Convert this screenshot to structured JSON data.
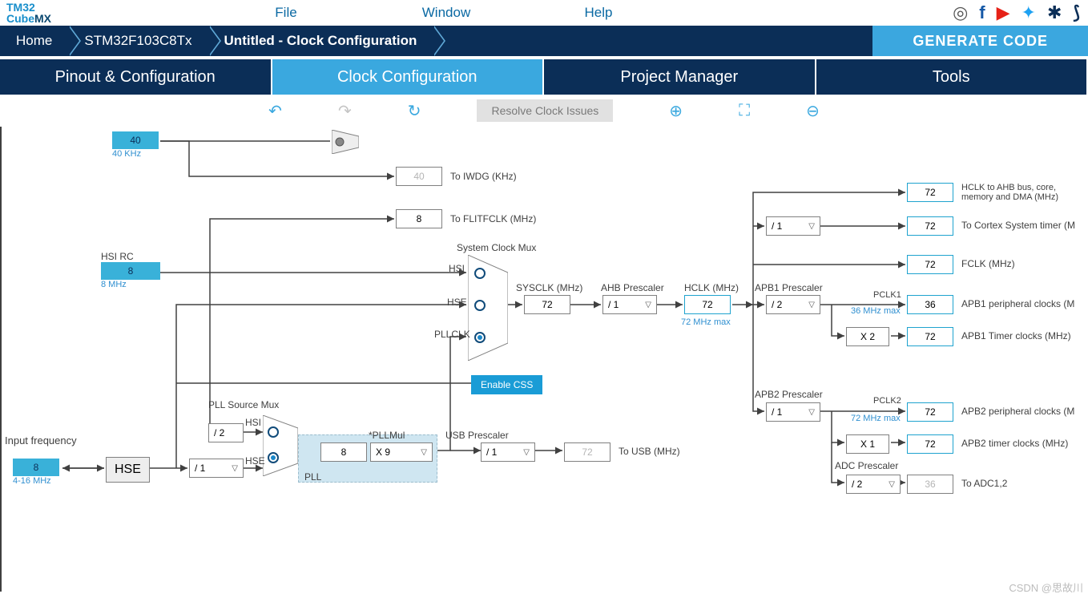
{
  "app_logo": {
    "l1": "TM32",
    "l2": "Cube",
    "l3": "MX"
  },
  "menu": {
    "file": "File",
    "window": "Window",
    "help": "Help"
  },
  "crumbs": {
    "home": "Home",
    "chip": "STM32F103C8Tx",
    "proj": "Untitled - Clock Configuration"
  },
  "generate": "GENERATE CODE",
  "tabs": {
    "pinout": "Pinout & Configuration",
    "clock": "Clock Configuration",
    "pm": "Project Manager",
    "tools": "Tools"
  },
  "toolbar": {
    "resolve": "Resolve Clock Issues"
  },
  "lsi": {
    "val": "40",
    "unit": "40 KHz"
  },
  "iwdg": {
    "val": "40",
    "label": "To IWDG (KHz)"
  },
  "flitf": {
    "val": "8",
    "label": "To FLITFCLK (MHz)"
  },
  "hsi": {
    "title": "HSI RC",
    "val": "8",
    "unit": "8 MHz"
  },
  "input_freq": {
    "title": "Input frequency",
    "val": "8",
    "unit": "4-16 MHz"
  },
  "hse_box": "HSE",
  "hse_div": "/ 1",
  "pll": {
    "title": "PLL Source Mux",
    "hsi": "HSI",
    "hse": "HSE",
    "div": "/ 2",
    "val": "8",
    "mul_lbl": "*PLLMul",
    "mul": "X 9",
    "name": "PLL"
  },
  "sysmux": {
    "title": "System Clock Mux",
    "hsi": "HSI",
    "hse": "HSE",
    "pll": "PLLCLK"
  },
  "css": "Enable CSS",
  "sysclk": {
    "label": "SYSCLK (MHz)",
    "val": "72"
  },
  "ahb": {
    "label": "AHB Prescaler",
    "val": "/ 1"
  },
  "hclk": {
    "label": "HCLK (MHz)",
    "val": "72",
    "max": "72 MHz max"
  },
  "usb": {
    "pre": "USB Prescaler",
    "div": "/ 1",
    "val": "72",
    "label": "To USB (MHz)"
  },
  "out_hclk": {
    "val": "72",
    "label": "HCLK to AHB bus, core, memory and DMA (MHz)"
  },
  "cortex": {
    "div": "/ 1",
    "val": "72",
    "label": "To Cortex System timer (M"
  },
  "fclk": {
    "val": "72",
    "label": "FCLK (MHz)"
  },
  "apb1": {
    "title": "APB1 Prescaler",
    "div": "/ 2",
    "pclk": "PCLK1",
    "max": "36 MHz max",
    "periph_val": "36",
    "periph": "APB1 peripheral clocks (M",
    "tmul": "X 2",
    "timer_val": "72",
    "timer": "APB1 Timer clocks (MHz)"
  },
  "apb2": {
    "title": "APB2 Prescaler",
    "div": "/ 1",
    "pclk": "PCLK2",
    "max": "72 MHz max",
    "periph_val": "72",
    "periph": "APB2 peripheral clocks (M",
    "tmul": "X 1",
    "timer_val": "72",
    "timer": "APB2 timer clocks (MHz)"
  },
  "adc": {
    "title": "ADC Prescaler",
    "div": "/ 2",
    "val": "36",
    "label": "To ADC1,2"
  },
  "watermark": "CSDN @思故川"
}
